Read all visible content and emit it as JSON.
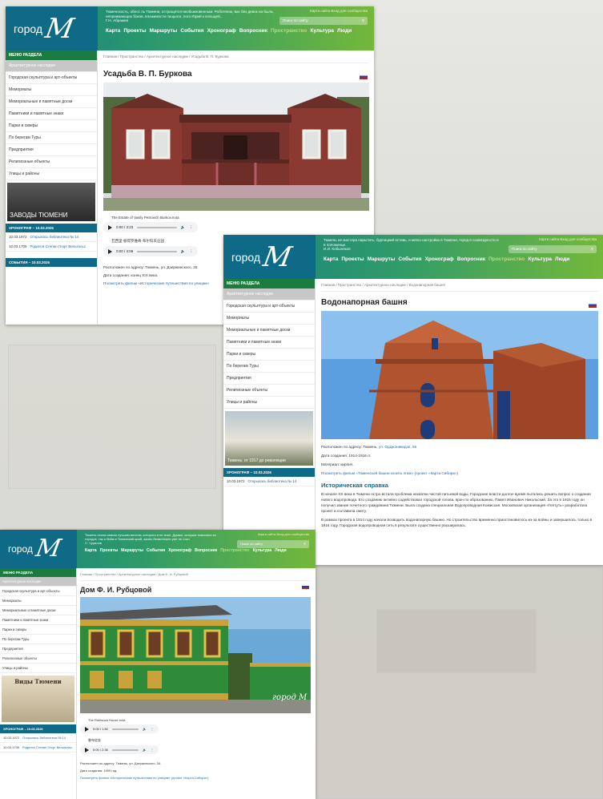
{
  "windows": [
    {
      "logo": {
        "word": "город",
        "letter": "M"
      },
      "quote": "Тюменскость, обесс ль Тюмени, остращется необыкновенным. Роботенок, вас без девок на была, неприимающих боков, влажимости пащьоги, пого Юрий к кольщей...",
      "quote_author": "Г.Н. Абражев",
      "top_links": "Карта сайта Вход для сообщества",
      "search_placeholder": "Поиск по сайту",
      "nav": [
        "Карта",
        "Проекты",
        "Маршруты",
        "События",
        "Хронограф",
        "Вопросник",
        "Пространство",
        "Культура",
        "Люди"
      ],
      "menu_header": "МЕНЮ РАЗДЕЛА",
      "menu": [
        "Архитектурное наследие",
        "Городская скульптура и арт-объекты",
        "Мемориалы",
        "Мемориальные и памятные доски",
        "Памятники и памятные знаки",
        "Парки и скверы",
        "По берегам Туры",
        "Предприятия",
        "Религиозные объекты",
        "Улицы и районы"
      ],
      "promo": "ЗАВОДЫ ТЮМЕНИ",
      "chrono_header": "ХРОНОГРАФ – 10.03.2026",
      "chrono": [
        {
          "date": "10.03.1972",
          "text": "Открылась библиотека № 14"
        },
        {
          "date": "10.03.1709",
          "text": "Родился Степан Георг Вельтальс"
        }
      ],
      "events_header": "СОБЫТИЯ – 10.03.2026",
      "breadcrumb": "Главная / Пространство / Архитектурное наследие / Усадьба В. П. Буркова",
      "title": "Усадьба В. П. Буркова",
      "audio": [
        {
          "title": "The Estate of Vasily Petrovich Burkov.m4a",
          "time": "0:00 / 3:23"
        },
        {
          "title": "瓦西里·彼得罗维奇·布尔科夫庄园",
          "time": "0:00 / 4:09"
        }
      ],
      "address": "Расположен по адресу: Тюмень, ул. Дзержинского, 26",
      "created": "Дата создания: конец XIX века.",
      "film": "Посмотреть фильм «Исторические путешествия по улицам»"
    },
    {
      "logo": {
        "word": "город",
        "letter": "M"
      },
      "quote": "Тюмень не мастера нарытить, бурлацкий вставь, и мягко настройка в Тюмени, город в созвездности и в положенце.",
      "quote_author": "И.И. Кобыняков",
      "top_links": "Карта сайта Вход для сообщества",
      "search_placeholder": "Поиск по сайту",
      "nav": [
        "Карта",
        "Проекты",
        "Маршруты",
        "События",
        "Хронограф",
        "Вопросник",
        "Пространство",
        "Культура",
        "Люди"
      ],
      "menu_header": "МЕНЮ РАЗДЕЛА",
      "menu": [
        "Архитектурное наследие",
        "Городская скульптура и арт-объекты",
        "Мемориалы",
        "Мемориальные и памятные доски",
        "Памятники и памятные знаки",
        "Парки и скверы",
        "По берегам Туры",
        "Предприятия",
        "Религиозные объекты",
        "Улицы и районы"
      ],
      "promo": "Тюмень: от 1917 до революции",
      "chrono_header": "ХРОНОГРАФ – 10.03.2026",
      "chrono": [
        {
          "date": "10.03.1972",
          "text": "Открылась библиотека № 14"
        }
      ],
      "breadcrumb": "Главная / Пространство / Архитектурное наследие / Водонапорная башня",
      "title": "Водонапорная башня",
      "address_label": "Расположен по адресу: Тюмень,",
      "address_link": "ул. Орджоникидзе, 56",
      "created": "Дата создания: 1914-1916 гг.",
      "material": "Материал: кирпич.",
      "film": "Посмотреть фильм «Тюменской башни скоить этаж» (проект «Карта Сибири»)",
      "history_title": "Историческая справка",
      "history_p1": "В начале XX века в Тюмени остро встала проблема нехватки чистой питьевой воды. Городские власти долгое время пытались решить вопрос о создании нового водопровода. Его созданию активно содействовал городской голова, врач по образованию, Павел Иванович Никольский. За это в 1916 году он получил звание почетного гражданина Тюмени. Была создана специальная Водопроводная Комиссия. Московская организация «Гелтуть» разработала проект и составила смету.",
      "history_p2": "В рамках проекта в 1914 году начали возводить водонапорную башню. Но строительство временно приостановилось из-за войны и завершилось только в 1916 году. Городская водопроводная сеть в результате существенно расширилась."
    },
    {
      "logo": {
        "word": "город",
        "letter": "M"
      },
      "quote": "Тюмень стала самым лучшим местом, которого я не знал. Думаю, которые повлияли из городов, так и бьём в Тюменский край, жизнь безмятежно уже не стал.",
      "quote_author": "С. Чурилов",
      "top_links": "Карта сайта Вход для сообщества",
      "search_placeholder": "Поиск по сайту",
      "nav": [
        "Карта",
        "Проекты",
        "Маршруты",
        "События",
        "Хронограф",
        "Вопросник",
        "Пространство",
        "Культура",
        "Люди"
      ],
      "menu_header": "МЕНЮ РАЗДЕЛА",
      "menu": [
        "Архитектурное наследие",
        "Городская скульптура и арт-объекты",
        "Мемориалы",
        "Мемориальные и памятные доски",
        "Памятники и памятные знаки",
        "Парки и скверы",
        "По берегам Туры",
        "Предприятия",
        "Религиозные объекты",
        "Улицы и районы"
      ],
      "promo": "Виды Тюмени",
      "chrono_header": "ХРОНОГРАФ – 10.03.2026",
      "chrono": [
        {
          "date": "10.03.1972",
          "text": "Открылась библиотека № 14"
        },
        {
          "date": "10.03.1709",
          "text": "Родился Степан Георг Вельтальс"
        }
      ],
      "breadcrumb": "Главная / Пространство / Архитектурное наследие / Дом Ф. И. Рубцовой",
      "title": "Дом Ф. И. Рубцовой",
      "audio": [
        {
          "title": "The Rubtsova House.m4a",
          "time": "0:00 / 1:50"
        },
        {
          "title": "鲁布佐娃",
          "time": "0:00 / 2:36"
        }
      ],
      "address": "Расположен по адресу: Тюмень, ул. Дзержинского, 34.",
      "created": "Дата создания: 1909 год.",
      "film": "Посмотреть фильм «Исторические путешествия по улицам» (проект «Карта Сибири»)"
    }
  ]
}
